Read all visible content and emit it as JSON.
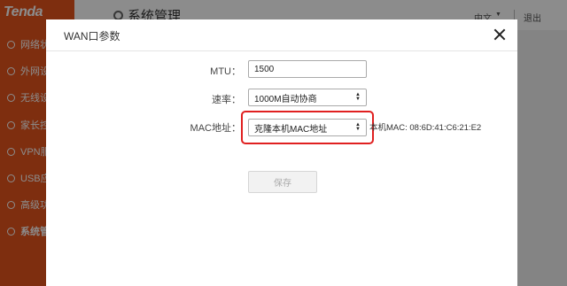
{
  "app": {
    "logo": "Tenda",
    "page_title": "系统管理",
    "language": "中文",
    "logout": "退出",
    "sidebar": [
      {
        "label": "网络状态"
      },
      {
        "label": "外网设置"
      },
      {
        "label": "无线设置"
      },
      {
        "label": "家长控制"
      },
      {
        "label": "VPN服务"
      },
      {
        "label": "USB应用"
      },
      {
        "label": "高级功能"
      },
      {
        "label": "系统管理"
      }
    ]
  },
  "modal": {
    "title": "WAN口参数",
    "mtu": {
      "label": "MTU：",
      "value": "1500"
    },
    "rate": {
      "label": "速率：",
      "value": "1000M自动协商"
    },
    "mac": {
      "label": "MAC地址：",
      "value": "克隆本机MAC地址",
      "info": "本机MAC: 08:6D:41:C6:21:E2"
    },
    "save_label": "保存"
  },
  "colors": {
    "brand": "#e5541c",
    "highlight": "#e02020"
  }
}
